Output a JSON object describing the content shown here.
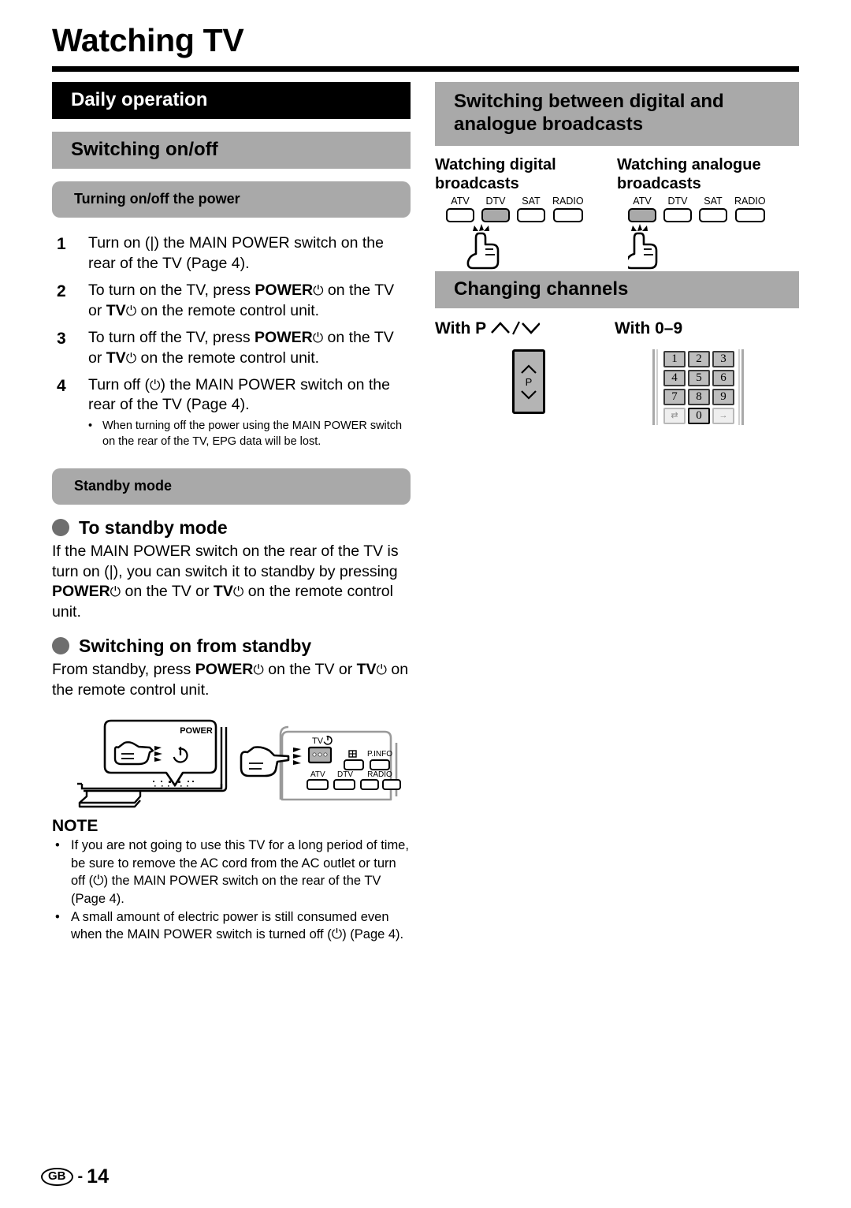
{
  "document": {
    "title": "Watching TV"
  },
  "left_column": {
    "banner_black": "Daily operation",
    "banner_grey": "Switching on/off",
    "subbanner": "Turning on/off the power",
    "steps": [
      {
        "num": "1",
        "text": "Turn on (|) the MAIN POWER switch on the rear of the TV (Page 4)."
      },
      {
        "num": "2",
        "text": "To turn on the TV, press POWER⏻ on the TV or TV⏻ on the remote control unit."
      },
      {
        "num": "3",
        "text": "To turn off the TV, press POWER⏻ on the TV or TV⏻ on the remote control unit."
      },
      {
        "num": "4",
        "text": "Turn off (⏻) the MAIN POWER switch on the rear of the TV (Page 4).",
        "sub_bullet": "When turning off the power using the MAIN POWER switch on the rear of the TV, EPG data will be lost."
      }
    ],
    "standby_banner": "Standby mode",
    "standby_sections": [
      {
        "heading": "To standby mode",
        "body": "If the MAIN POWER switch on the rear of the TV is turn on (|), you can switch it to standby by pressing POWER⏻ on the TV or TV⏻ on the remote control unit."
      },
      {
        "heading": "Switching on from standby",
        "body": "From standby, press POWER⏻ on the TV or TV⏻ on the remote control unit."
      }
    ],
    "illustration": {
      "tv_callout_label": "POWER",
      "remote_label_tv": "TV",
      "remote_keys_top": [
        "P.INFO"
      ],
      "remote_keys_bottom": [
        "ATV",
        "DTV",
        "RADIO"
      ]
    },
    "note": {
      "title": "NOTE",
      "items": [
        "If you are not going to use this TV for a long period of time, be sure to remove the AC cord from the AC outlet or turn off (⏻) the MAIN POWER switch on the rear of the TV (Page 4).",
        "A small amount of electric power is still consumed even when the MAIN POWER switch is turned off (⏻) (Page 4)."
      ]
    }
  },
  "right_column": {
    "banner_switching": "Switching between digital and analogue broadcasts",
    "watch_digital": {
      "title": "Watching digital broadcasts",
      "keys": [
        "ATV",
        "DTV",
        "SAT",
        "RADIO"
      ],
      "active_key": "DTV"
    },
    "watch_analogue": {
      "title": "Watching analogue broadcasts",
      "keys": [
        "ATV",
        "DTV",
        "SAT",
        "RADIO"
      ],
      "active_key": "ATV"
    },
    "banner_channels": "Changing channels",
    "with_p_label": "With P",
    "with_p_suffix": "/",
    "with_09_label": "With 0–9",
    "p_key_letter": "P",
    "keypad": {
      "rows": [
        [
          "1",
          "2",
          "3"
        ],
        [
          "4",
          "5",
          "6"
        ],
        [
          "7",
          "8",
          "9"
        ]
      ],
      "bottom_row": [
        "⇄",
        "0",
        "→"
      ]
    }
  },
  "footer": {
    "region": "GB",
    "dash": "-",
    "page_number": "14"
  },
  "colors": {
    "banner_black": "#000000",
    "banner_grey": "#a9a9a9",
    "bullet_circle": "#6e6e6e",
    "key_active": "#a9a9a9"
  }
}
